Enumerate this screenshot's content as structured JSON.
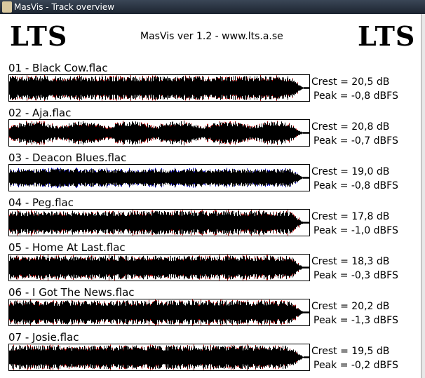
{
  "window": {
    "title": "MasVis - Track overview"
  },
  "header": {
    "logo_left": "LTS",
    "logo_right": "LTS",
    "version": "MasVis ver 1.2 - www.lts.a.se"
  },
  "tracks": [
    {
      "name": "01 - Black Cow.flac",
      "crest": "Crest = 20,5 dB",
      "peak": "Peak = -0,8 dBFS",
      "accent": "#c00000"
    },
    {
      "name": "02 - Aja.flac",
      "crest": "Crest = 20,8 dB",
      "peak": "Peak = -0,7 dBFS",
      "accent": "#c00000"
    },
    {
      "name": "03 - Deacon Blues.flac",
      "crest": "Crest = 19,0 dB",
      "peak": "Peak = -0,8 dBFS",
      "accent": "#0000c0"
    },
    {
      "name": "04 - Peg.flac",
      "crest": "Crest = 17,8 dB",
      "peak": "Peak = -1,0 dBFS",
      "accent": "#c00000"
    },
    {
      "name": "05 - Home At Last.flac",
      "crest": "Crest = 18,3 dB",
      "peak": "Peak = -0,3 dBFS",
      "accent": "#c00000"
    },
    {
      "name": "06 - I Got The News.flac",
      "crest": "Crest = 20,2 dB",
      "peak": "Peak = -1,3 dBFS",
      "accent": "#c00000"
    },
    {
      "name": "07 - Josie.flac",
      "crest": "Crest = 19,5 dB",
      "peak": "Peak = -0,2 dBFS",
      "accent": "#c00000"
    }
  ]
}
